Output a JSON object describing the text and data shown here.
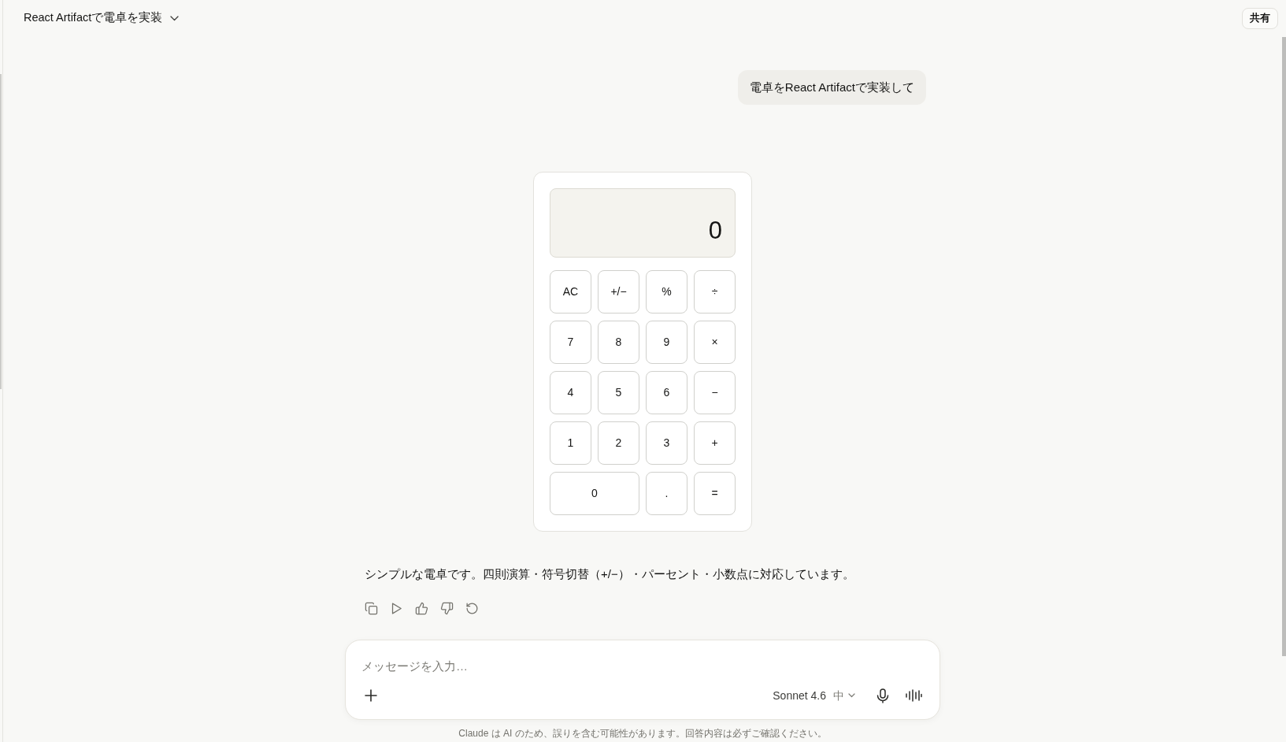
{
  "header": {
    "title": "React Artifactで電卓を実装",
    "share_button": "共有"
  },
  "messages": [
    {
      "kind": "user",
      "text": "電卓をReact Artifactで実装して"
    },
    {
      "kind": "artifact",
      "calculator": {
        "display": "0",
        "keys": [
          {
            "label": "AC",
            "wide": false
          },
          {
            "label": "+/−",
            "wide": false
          },
          {
            "label": "%",
            "wide": false
          },
          {
            "label": "÷",
            "wide": false
          },
          {
            "label": "7",
            "wide": false
          },
          {
            "label": "8",
            "wide": false
          },
          {
            "label": "9",
            "wide": false
          },
          {
            "label": "×",
            "wide": false
          },
          {
            "label": "4",
            "wide": false
          },
          {
            "label": "5",
            "wide": false
          },
          {
            "label": "6",
            "wide": false
          },
          {
            "label": "−",
            "wide": false
          },
          {
            "label": "1",
            "wide": false
          },
          {
            "label": "2",
            "wide": false
          },
          {
            "label": "3",
            "wide": false
          },
          {
            "label": "+",
            "wide": false
          },
          {
            "label": "0",
            "wide": true
          },
          {
            "label": ".",
            "wide": false
          },
          {
            "label": "=",
            "wide": false
          }
        ]
      }
    },
    {
      "kind": "assistant",
      "text": "シンプルな電卓です。四則演算・符号切替（+/−）・パーセント・小数点に対応しています。"
    }
  ],
  "composer": {
    "placeholder": "メッセージを入力…",
    "model": "Sonnet 4.6",
    "effort": "中"
  },
  "disclaimer": "Claude は AI のため、誤りを含む可能性があります。回答内容は必ずご確認ください。"
}
